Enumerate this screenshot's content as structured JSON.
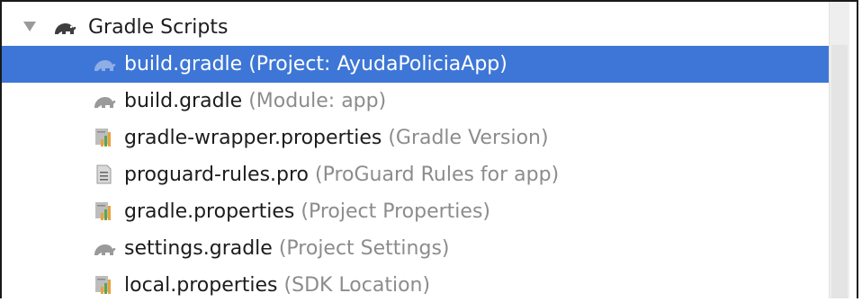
{
  "tree": {
    "root": {
      "label": "Gradle Scripts",
      "icon": "gradle-elephant-icon",
      "expanded": true
    },
    "items": [
      {
        "name": "build.gradle",
        "hint": "(Project: AyudaPoliciaApp)",
        "icon": "gradle-elephant-icon",
        "selected": true
      },
      {
        "name": "build.gradle",
        "hint": "(Module: app)",
        "icon": "gradle-elephant-icon",
        "selected": false
      },
      {
        "name": "gradle-wrapper.properties",
        "hint": "(Gradle Version)",
        "icon": "properties-file-icon",
        "selected": false
      },
      {
        "name": "proguard-rules.pro",
        "hint": "(ProGuard Rules for app)",
        "icon": "text-file-icon",
        "selected": false
      },
      {
        "name": "gradle.properties",
        "hint": "(Project Properties)",
        "icon": "properties-file-icon",
        "selected": false
      },
      {
        "name": "settings.gradle",
        "hint": "(Project Settings)",
        "icon": "gradle-elephant-icon",
        "selected": false
      },
      {
        "name": "local.properties",
        "hint": "(SDK Location)",
        "icon": "properties-file-icon",
        "selected": false
      }
    ]
  },
  "colors": {
    "selection": "#3d76d6",
    "hint_text": "#8c8c8c",
    "elephant_root": "#3e3e3e",
    "elephant_child": "#9a9a9a"
  }
}
